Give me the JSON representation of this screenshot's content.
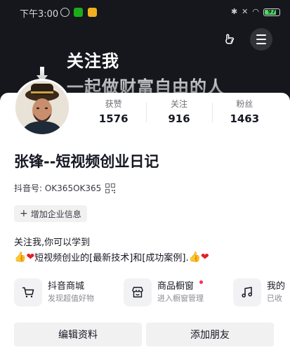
{
  "status_bar": {
    "time": "下午3:00",
    "battery": "97",
    "icons": [
      "alarm-icon",
      "wechat-icon",
      "message-icon",
      "bluetooth-icon",
      "mute-icon",
      "wifi-icon",
      "battery-icon"
    ]
  },
  "header": {
    "banner_line1": "关注我",
    "banner_line2": "一起做财富自由的人",
    "buttons": [
      "hand-icon",
      "menu-icon"
    ]
  },
  "profile": {
    "name": "张锋--短视频创业日记",
    "douyin_id": "抖音号: OK365OK365",
    "add_business_info": "增加企业信息",
    "bio_line1": "关注我,你可以学到",
    "bio_line2_text1": "短视频创业的[最新技术]和[成功案例].",
    "stats": [
      {
        "label": "获赞",
        "value": "1576"
      },
      {
        "label": "关注",
        "value": "916"
      },
      {
        "label": "粉丝",
        "value": "1463"
      }
    ]
  },
  "shortcuts": [
    {
      "title": "抖音商城",
      "subtitle": "发现超值好物",
      "icon": "cart-icon"
    },
    {
      "title": "商品橱窗",
      "subtitle": "进入橱窗管理",
      "icon": "storefront-icon"
    },
    {
      "title": "我的",
      "subtitle": "已收",
      "icon": "music-note-icon"
    }
  ],
  "actions": {
    "edit_profile": "编辑资料",
    "add_friend": "添加朋友"
  },
  "colors": {
    "banner_bg": "#15171d",
    "accent_red": "#fe2c55",
    "button_bg": "#f1f1f2"
  }
}
